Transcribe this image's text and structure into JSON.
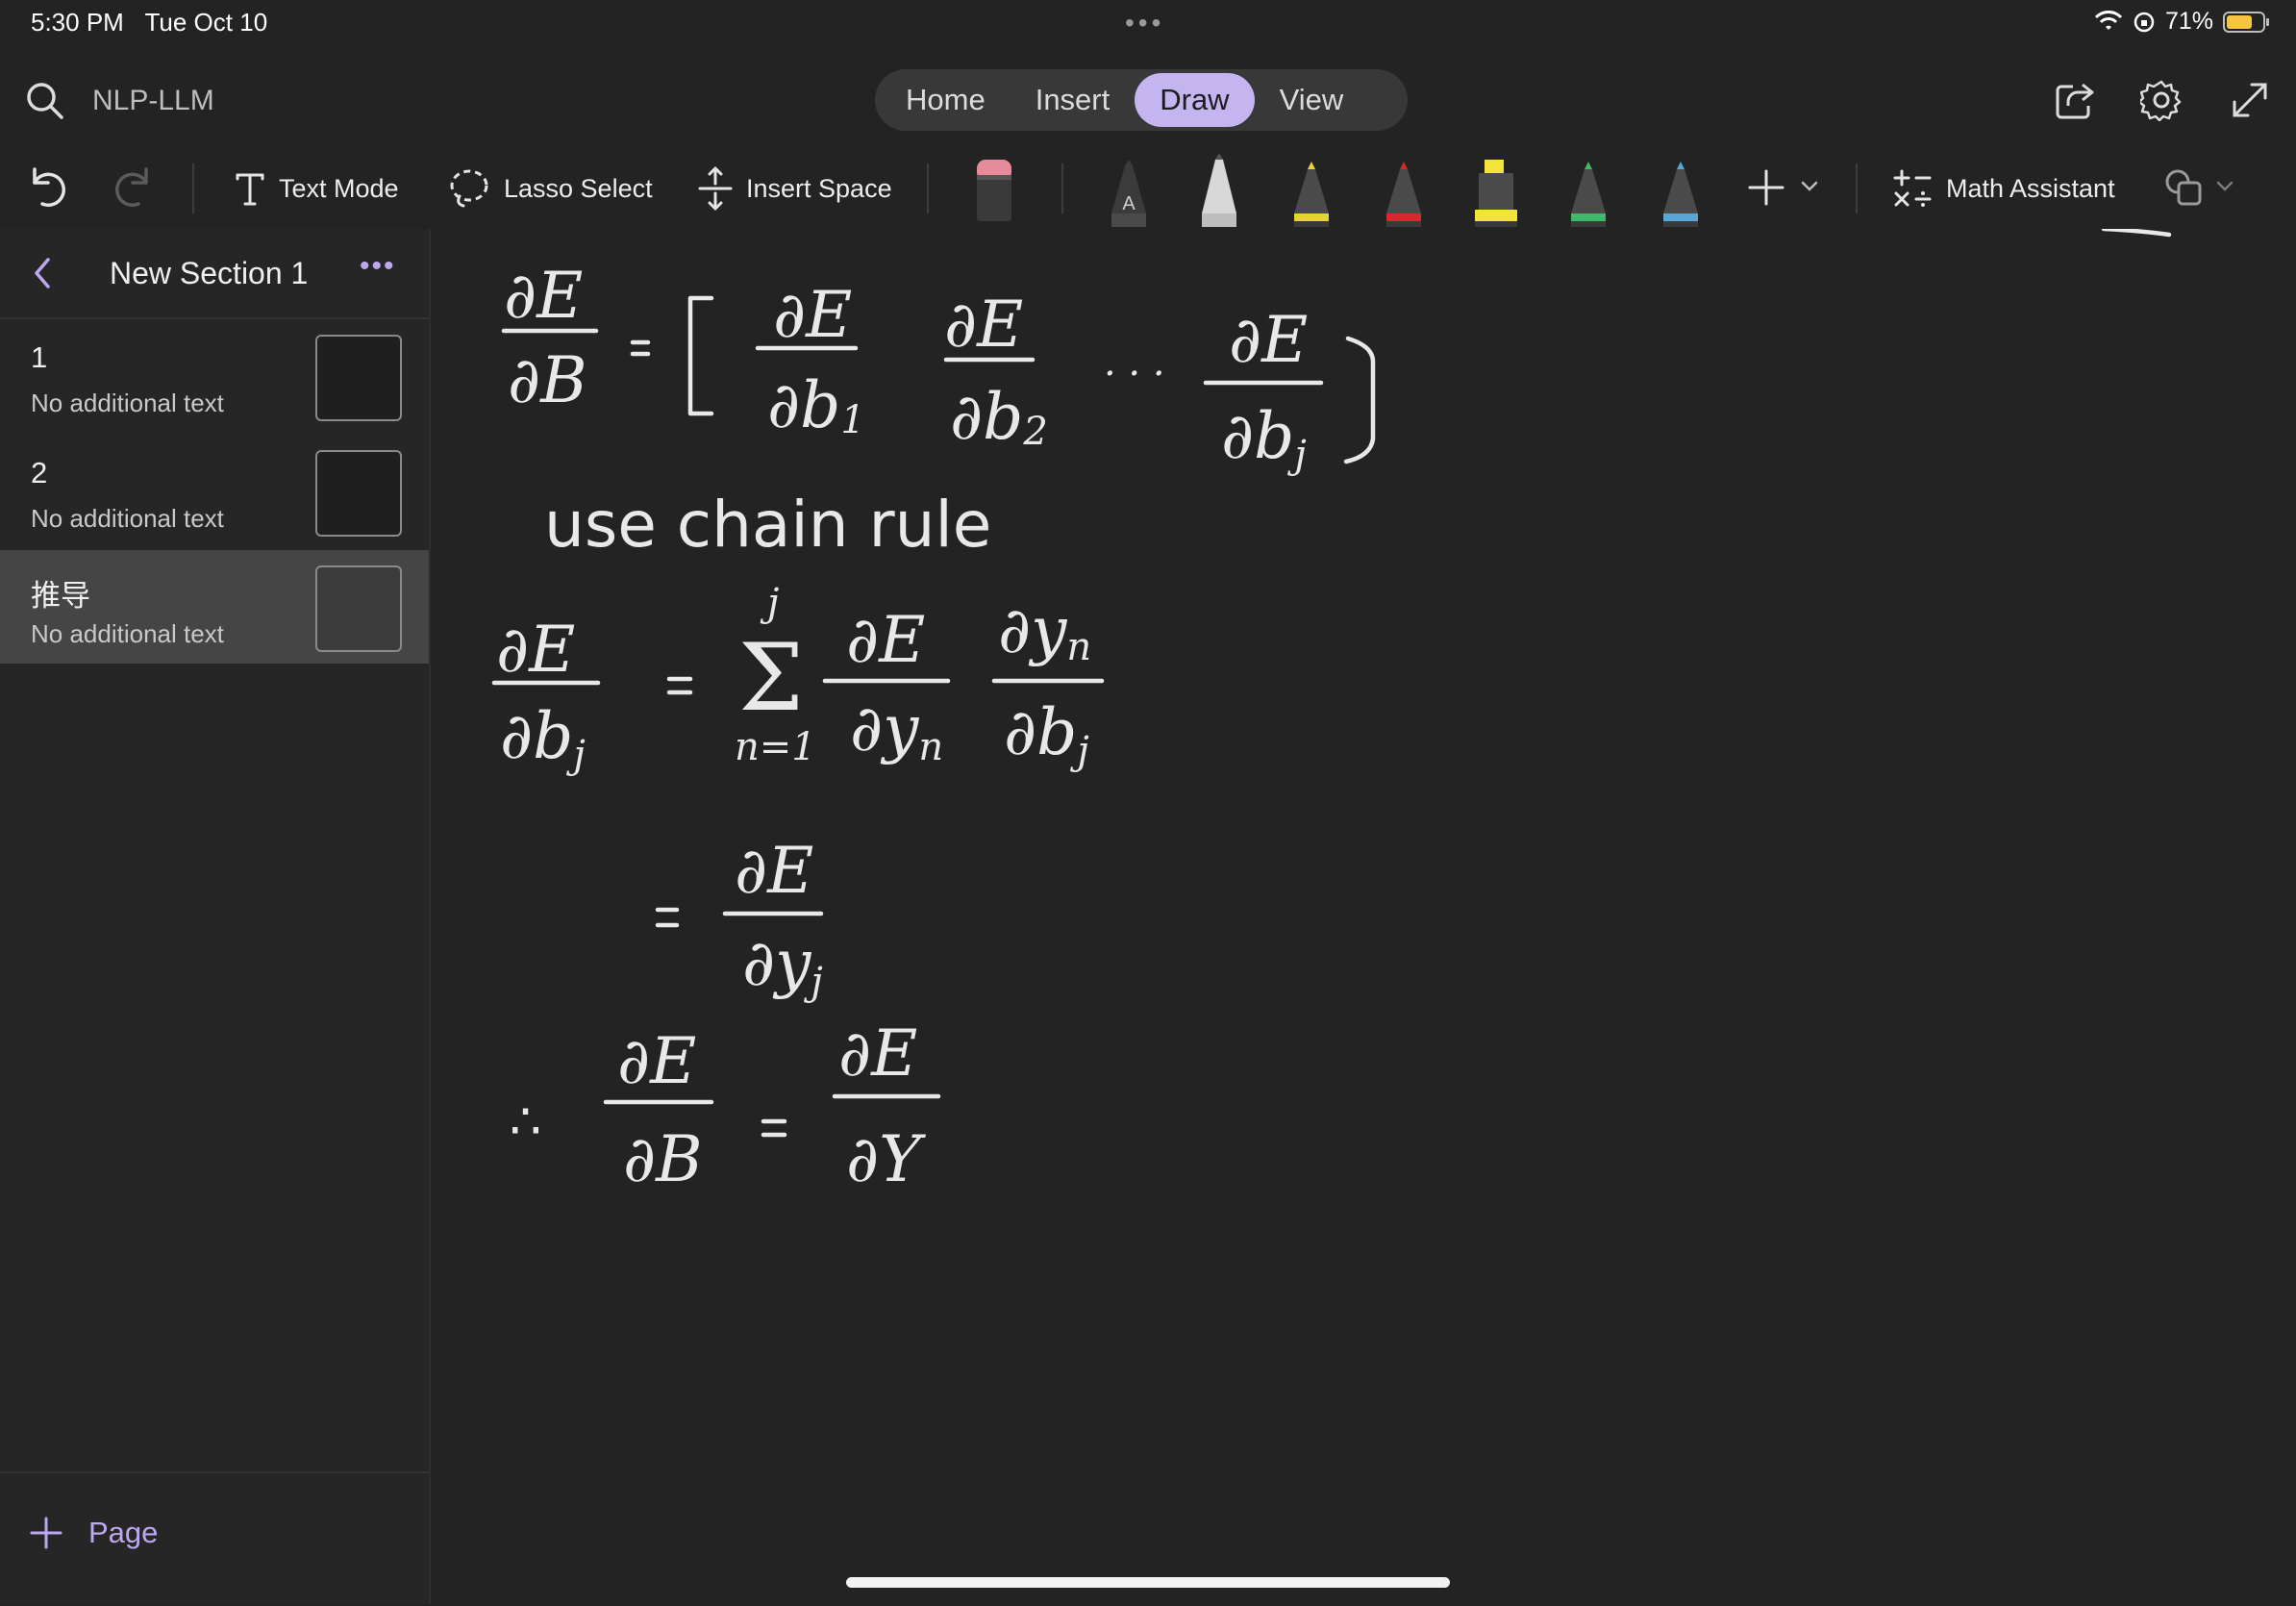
{
  "status": {
    "time": "5:30 PM",
    "date": "Tue Oct 10",
    "battery": "71%",
    "battery_color": "#f5c542"
  },
  "topbar": {
    "notebook_name": "NLP-LLM",
    "tabs": [
      {
        "label": "Home",
        "active": false
      },
      {
        "label": "Insert",
        "active": false
      },
      {
        "label": "Draw",
        "active": true
      },
      {
        "label": "View",
        "active": false
      }
    ],
    "accent_color": "#c4b4ef"
  },
  "toolbar": {
    "text_mode": "Text Mode",
    "lasso_select": "Lasso Select",
    "insert_space": "Insert Space",
    "math_assistant": "Math Assistant",
    "pens": [
      {
        "name": "eraser",
        "color": "#e58b9a"
      },
      {
        "name": "pen-dark-A",
        "color": "#2b2b2b"
      },
      {
        "name": "pen-white",
        "color": "#d8d8d8"
      },
      {
        "name": "pen-yellow",
        "color": "#e6d23a"
      },
      {
        "name": "pen-red",
        "color": "#d02a2a"
      },
      {
        "name": "highlighter-yellow",
        "color": "#f2e43a"
      },
      {
        "name": "pen-green",
        "color": "#3fb86a"
      },
      {
        "name": "pen-blue",
        "color": "#59a5d8"
      }
    ]
  },
  "sidebar": {
    "section_title": "New Section 1",
    "pages": [
      {
        "title": "1",
        "subtitle": "No additional text",
        "active": false
      },
      {
        "title": "2",
        "subtitle": "No additional text",
        "active": false
      },
      {
        "title": "推导",
        "subtitle": "No additional text",
        "active": true
      }
    ],
    "add_page_label": "Page"
  },
  "canvas": {
    "ink_text": {
      "line1_note": "use chain rule"
    }
  }
}
